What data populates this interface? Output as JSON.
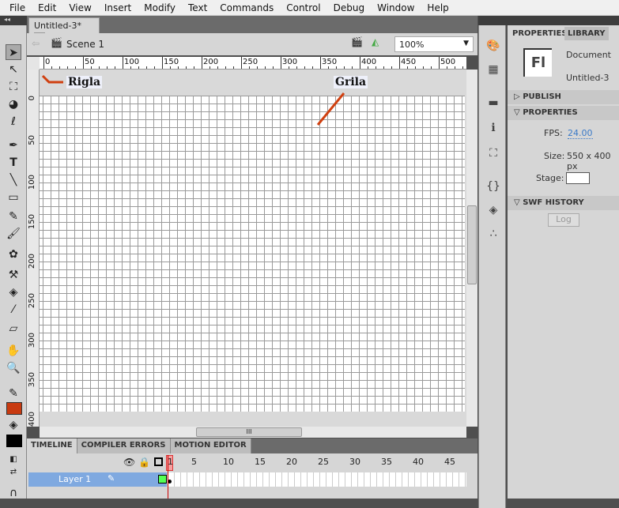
{
  "menu": [
    "File",
    "Edit",
    "View",
    "Insert",
    "Modify",
    "Text",
    "Commands",
    "Control",
    "Debug",
    "Window",
    "Help"
  ],
  "document": {
    "tab": "Untitled-3*",
    "scene": "Scene 1",
    "zoom": "100%"
  },
  "ruler": {
    "h": [
      "0",
      "50",
      "100",
      "150",
      "200",
      "250",
      "300",
      "350",
      "400",
      "450",
      "500"
    ],
    "v": [
      "0",
      "50",
      "100",
      "150",
      "200",
      "250",
      "300",
      "350",
      "400"
    ]
  },
  "annotations": {
    "ruler": "Rigla",
    "grid": "Grila"
  },
  "timeline": {
    "tabs": [
      "TIMELINE",
      "COMPILER ERRORS",
      "MOTION EDITOR"
    ],
    "frames": [
      "1",
      "5",
      "10",
      "15",
      "20",
      "25",
      "30",
      "35",
      "40",
      "45"
    ],
    "layer": "Layer 1"
  },
  "properties": {
    "tabs": [
      "PROPERTIES",
      "LIBRARY"
    ],
    "doc_type": "Document",
    "doc_name": "Untitled-3",
    "logo": "Fl",
    "publish": "PUBLISH",
    "section": "PROPERTIES",
    "fps_label": "FPS:",
    "fps": "24.00",
    "size_label": "Size:",
    "size": "550 x 400 px",
    "stage_label": "Stage:",
    "swf": "SWF HISTORY",
    "log": "Log"
  },
  "colors": {
    "stroke": "#c83a10",
    "fill": "#000000",
    "annotation": "#d04010",
    "layer_selected": "#7fa9e0"
  }
}
